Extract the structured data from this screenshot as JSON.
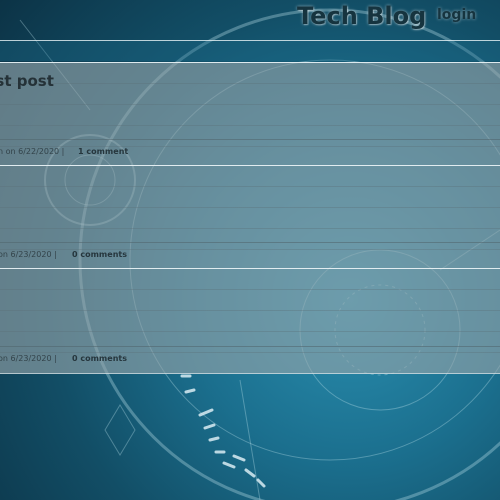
{
  "header": {
    "brand": "Tech Blog",
    "login_label": "login"
  },
  "posts": [
    {
      "title": "rst post",
      "meta": "n on 6/22/2020 |",
      "comments": "1 comment"
    },
    {
      "title": "",
      "meta": "on 6/23/2020 |",
      "comments": "0 comments"
    },
    {
      "title": "",
      "meta": "on 6/23/2020 |",
      "comments": "0 comments"
    }
  ],
  "colors": {
    "background": "#1b6f8e",
    "card": "#96a5aa",
    "text": "#16343f"
  }
}
